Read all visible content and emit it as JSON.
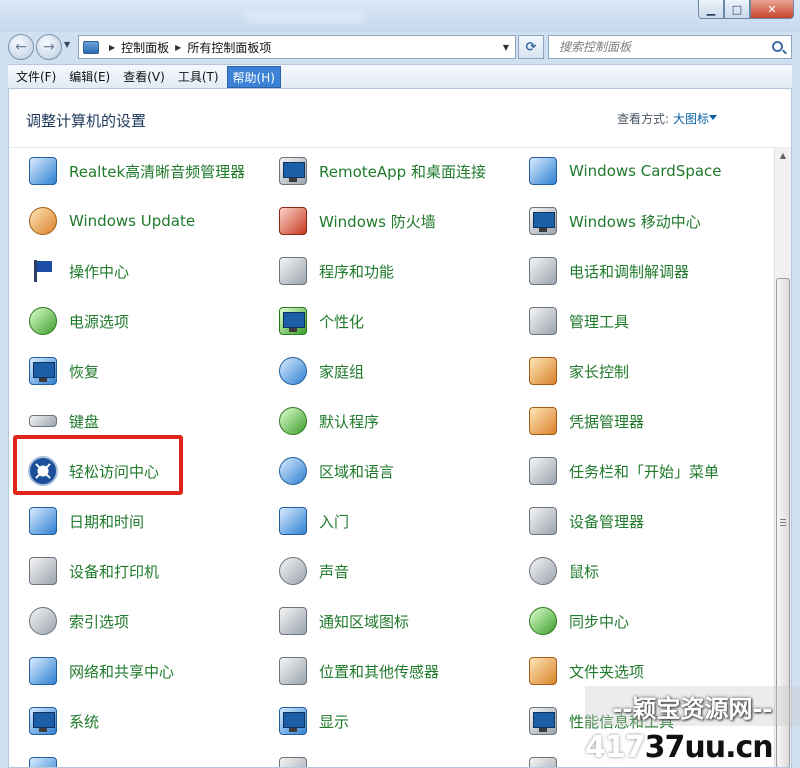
{
  "window": {
    "buttons": {
      "minimize": "▁",
      "maximize": "□",
      "close": "✕"
    }
  },
  "address_bar": {
    "back_icon": "←",
    "forward_icon": "→",
    "breadcrumb": [
      "控制面板",
      "所有控制面板项"
    ],
    "refresh_icon": "⟳",
    "search_placeholder": "搜索控制面板"
  },
  "menubar": {
    "items": [
      "文件(F)",
      "编辑(E)",
      "查看(V)",
      "工具(T)",
      "帮助(H)"
    ],
    "active_index": 4
  },
  "header": {
    "title": "调整计算机的设置",
    "view_by_label": "查看方式:",
    "view_by_value": "大图标"
  },
  "items": [
    {
      "label": "Realtek高清晰音频管理器",
      "icon": "audio-manager-icon"
    },
    {
      "label": "RemoteApp 和桌面连接",
      "icon": "remoteapp-icon"
    },
    {
      "label": "Windows CardSpace",
      "icon": "cardspace-icon"
    },
    {
      "label": "Windows Update",
      "icon": "windows-update-icon"
    },
    {
      "label": "Windows 防火墙",
      "icon": "firewall-icon"
    },
    {
      "label": "Windows 移动中心",
      "icon": "mobility-center-icon"
    },
    {
      "label": "操作中心",
      "icon": "action-center-flag-icon"
    },
    {
      "label": "程序和功能",
      "icon": "programs-features-icon"
    },
    {
      "label": "电话和调制解调器",
      "icon": "phone-modem-icon"
    },
    {
      "label": "电源选项",
      "icon": "power-options-icon"
    },
    {
      "label": "个性化",
      "icon": "personalization-icon"
    },
    {
      "label": "管理工具",
      "icon": "admin-tools-icon"
    },
    {
      "label": "恢复",
      "icon": "recovery-icon"
    },
    {
      "label": "家庭组",
      "icon": "homegroup-icon"
    },
    {
      "label": "家长控制",
      "icon": "parental-controls-icon"
    },
    {
      "label": "键盘",
      "icon": "keyboard-icon"
    },
    {
      "label": "默认程序",
      "icon": "default-programs-icon"
    },
    {
      "label": "凭据管理器",
      "icon": "credential-manager-icon"
    },
    {
      "label": "轻松访问中心",
      "icon": "ease-of-access-icon"
    },
    {
      "label": "区域和语言",
      "icon": "region-language-icon"
    },
    {
      "label": "任务栏和「开始」菜单",
      "icon": "taskbar-start-menu-icon"
    },
    {
      "label": "日期和时间",
      "icon": "date-time-icon"
    },
    {
      "label": "入门",
      "icon": "getting-started-icon"
    },
    {
      "label": "设备管理器",
      "icon": "device-manager-icon"
    },
    {
      "label": "设备和打印机",
      "icon": "devices-printers-icon"
    },
    {
      "label": "声音",
      "icon": "sound-icon"
    },
    {
      "label": "鼠标",
      "icon": "mouse-icon"
    },
    {
      "label": "索引选项",
      "icon": "indexing-options-icon"
    },
    {
      "label": "通知区域图标",
      "icon": "notification-area-icon"
    },
    {
      "label": "同步中心",
      "icon": "sync-center-icon"
    },
    {
      "label": "网络和共享中心",
      "icon": "network-sharing-icon"
    },
    {
      "label": "位置和其他传感器",
      "icon": "location-sensors-icon"
    },
    {
      "label": "文件夹选项",
      "icon": "folder-options-icon"
    },
    {
      "label": "系统",
      "icon": "system-icon"
    },
    {
      "label": "显示",
      "icon": "display-icon"
    },
    {
      "label": "性能信息和工具",
      "icon": "performance-icon"
    }
  ],
  "highlighted_item": "轻松访问中心",
  "watermark": {
    "top": "--颖宝资源网--",
    "number": "417",
    "domain": "37uu.cn"
  },
  "colors": {
    "item_text": "#1f7a2b",
    "title_text": "#1e395b",
    "link_blue": "#0b61a4",
    "highlight_red": "#e0261b",
    "menu_active": "#3b82d6"
  }
}
